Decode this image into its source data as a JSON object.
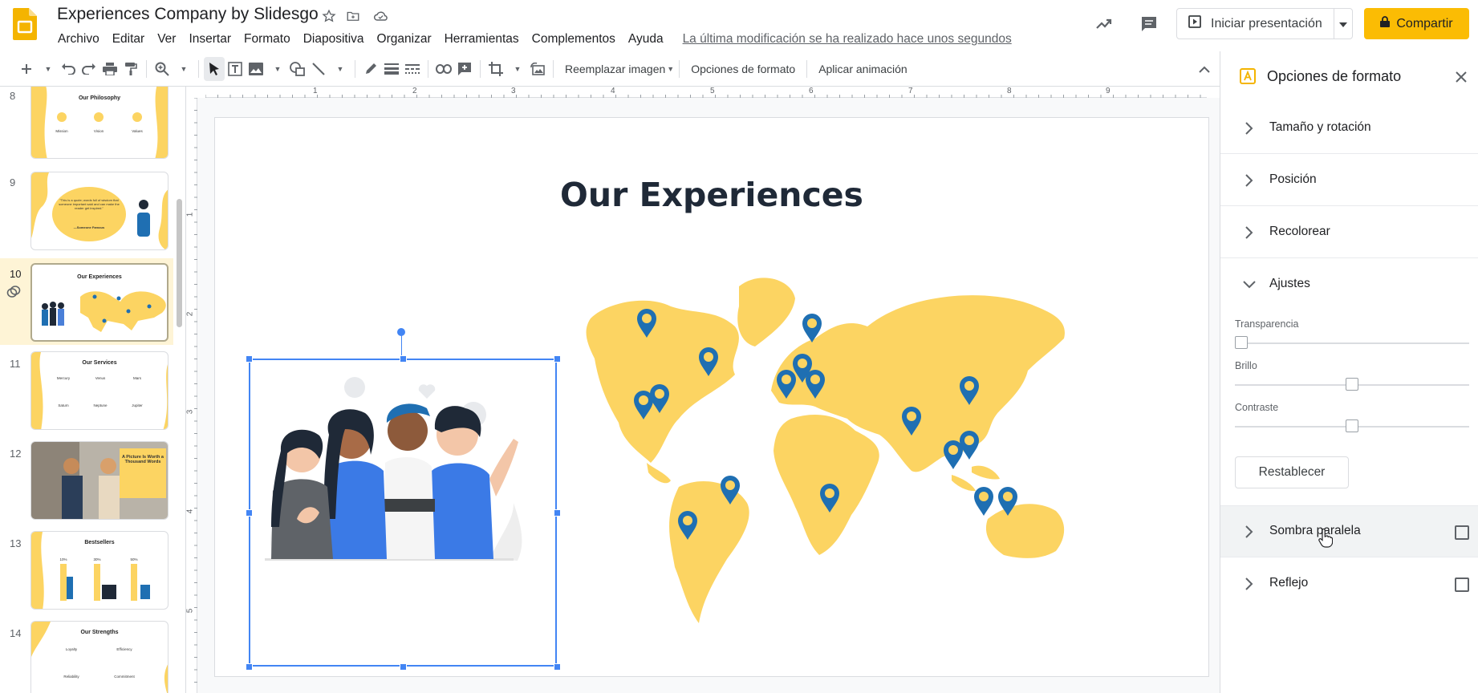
{
  "document": {
    "title": "Experiences Company by Slidesgo",
    "last_edit": "La última modificación se ha realizado hace unos segundos"
  },
  "menu": [
    "Archivo",
    "Editar",
    "Ver",
    "Insertar",
    "Formato",
    "Diapositiva",
    "Organizar",
    "Herramientas",
    "Complementos",
    "Ayuda"
  ],
  "header_actions": {
    "present_label": "Iniciar presentación",
    "share_label": "Compartir"
  },
  "toolbar": {
    "replace_image_label": "Reemplazar imagen",
    "format_options_label": "Opciones de formato",
    "animation_label": "Aplicar animación"
  },
  "rulers": {
    "horizontal": [
      "1",
      "2",
      "3",
      "4",
      "5",
      "6",
      "7",
      "8",
      "9"
    ],
    "vertical": [
      "1",
      "2",
      "3",
      "4",
      "5"
    ]
  },
  "filmstrip": {
    "slides": [
      {
        "number": "8",
        "title": "Our Philosophy",
        "labels": [
          "Mission",
          "Vision",
          "Values"
        ]
      },
      {
        "number": "9",
        "quote": "\"This is a quote; words full of wisdom that someone important said and can make the reader get inspired.\"",
        "author": "—Someone Famous"
      },
      {
        "number": "10",
        "title": "Our Experiences"
      },
      {
        "number": "11",
        "title": "Our Services",
        "labels": [
          "Mercury",
          "Venus",
          "Mars",
          "Saturn",
          "Neptune",
          "Jupiter"
        ]
      },
      {
        "number": "12",
        "title": "A Picture Is Worth a Thousand Words"
      },
      {
        "number": "13",
        "title": "Bestsellers",
        "labels": [
          "10%",
          "30%",
          "50%"
        ]
      },
      {
        "number": "14",
        "title": "Our Strengths",
        "labels": [
          "Loyalty",
          "Efficiency",
          "Reliability",
          "Commitment"
        ]
      }
    ]
  },
  "slide": {
    "title": "Our Experiences"
  },
  "format_panel": {
    "title": "Opciones de formato",
    "sections": {
      "size_rotation": "Tamaño y rotación",
      "position": "Posición",
      "recolor": "Recolorear",
      "adjustments": "Ajustes",
      "drop_shadow": "Sombra paralela",
      "reflection": "Reflejo"
    },
    "adjustments": {
      "transparency_label": "Transparencia",
      "transparency_value": 0,
      "brightness_label": "Brillo",
      "brightness_value": 0.5,
      "contrast_label": "Contraste",
      "contrast_value": 0.5,
      "reset_label": "Restablecer"
    },
    "drop_shadow_checked": false,
    "reflection_checked": false
  },
  "colors": {
    "accent_yellow": "#fbbc04",
    "map_yellow": "#fcd462",
    "pin_blue": "#1f6fb2",
    "selection_blue": "#4285f4",
    "selected_slide_bg": "#fef4d6"
  }
}
